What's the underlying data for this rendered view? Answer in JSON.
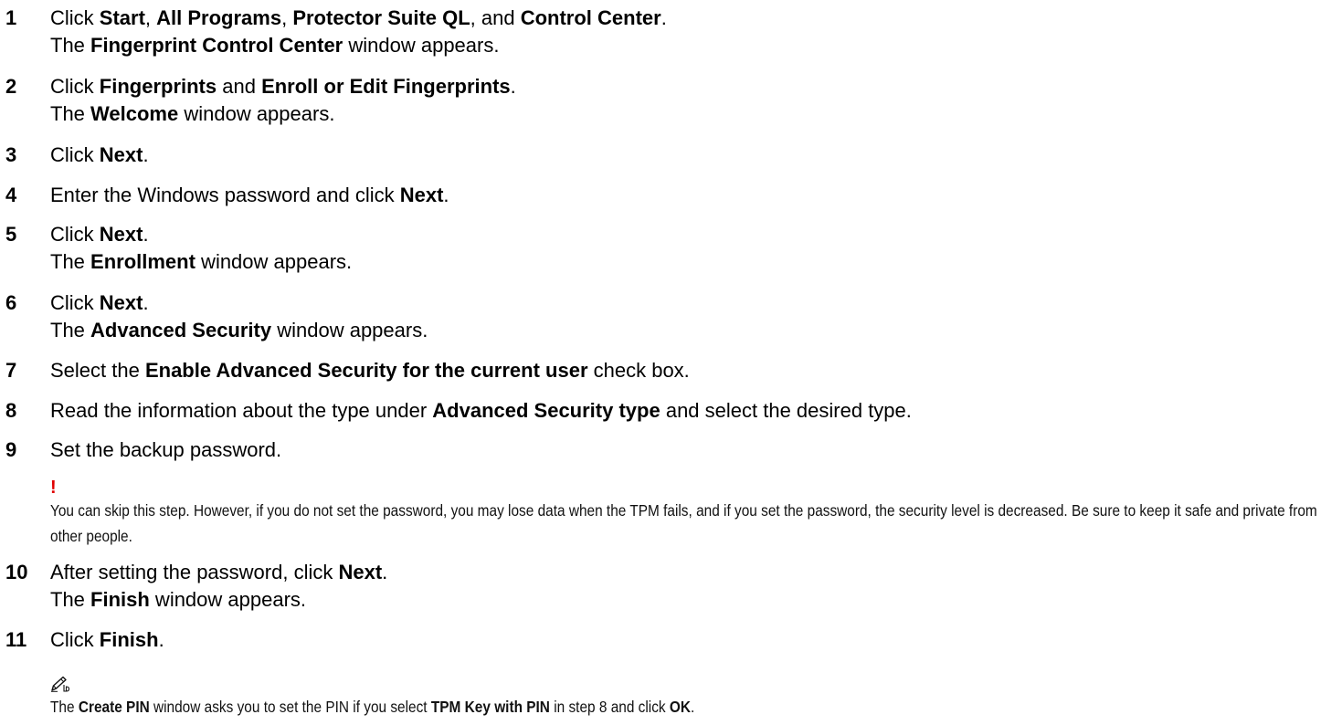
{
  "steps": [
    {
      "n": "1",
      "lines": [
        [
          {
            "t": "Click "
          },
          {
            "t": "Start",
            "b": 1
          },
          {
            "t": ", "
          },
          {
            "t": "All Programs",
            "b": 1
          },
          {
            "t": ", "
          },
          {
            "t": "Protector Suite QL",
            "b": 1
          },
          {
            "t": ", and "
          },
          {
            "t": "Control Center",
            "b": 1
          },
          {
            "t": "."
          }
        ],
        [
          {
            "t": "The "
          },
          {
            "t": "Fingerprint Control Center",
            "b": 1
          },
          {
            "t": " window appears."
          }
        ]
      ]
    },
    {
      "n": "2",
      "lines": [
        [
          {
            "t": "Click "
          },
          {
            "t": "Fingerprints",
            "b": 1
          },
          {
            "t": " and "
          },
          {
            "t": "Enroll or Edit Fingerprints",
            "b": 1
          },
          {
            "t": "."
          }
        ],
        [
          {
            "t": "The "
          },
          {
            "t": "Welcome",
            "b": 1
          },
          {
            "t": " window appears."
          }
        ]
      ]
    },
    {
      "n": "3",
      "lines": [
        [
          {
            "t": "Click "
          },
          {
            "t": "Next",
            "b": 1
          },
          {
            "t": "."
          }
        ]
      ]
    },
    {
      "n": "4",
      "lines": [
        [
          {
            "t": "Enter the Windows password and click "
          },
          {
            "t": "Next",
            "b": 1
          },
          {
            "t": "."
          }
        ]
      ]
    },
    {
      "n": "5",
      "lines": [
        [
          {
            "t": "Click "
          },
          {
            "t": "Next",
            "b": 1
          },
          {
            "t": "."
          }
        ],
        [
          {
            "t": "The "
          },
          {
            "t": "Enrollment",
            "b": 1
          },
          {
            "t": " window appears."
          }
        ]
      ]
    },
    {
      "n": "6",
      "lines": [
        [
          {
            "t": "Click "
          },
          {
            "t": "Next",
            "b": 1
          },
          {
            "t": "."
          }
        ],
        [
          {
            "t": "The "
          },
          {
            "t": "Advanced Security",
            "b": 1
          },
          {
            "t": " window appears."
          }
        ]
      ]
    },
    {
      "n": "7",
      "lines": [
        [
          {
            "t": "Select the "
          },
          {
            "t": "Enable Advanced Security for the current user",
            "b": 1
          },
          {
            "t": " check box."
          }
        ]
      ]
    },
    {
      "n": "8",
      "lines": [
        [
          {
            "t": "Read the information about the type under "
          },
          {
            "t": "Advanced Security type",
            "b": 1
          },
          {
            "t": " and select the desired type."
          }
        ]
      ]
    },
    {
      "n": "9",
      "lines": [
        [
          {
            "t": "Set the backup password."
          }
        ]
      ]
    },
    {
      "n": "10",
      "lines": [
        [
          {
            "t": "After setting the password, click "
          },
          {
            "t": "Next",
            "b": 1
          },
          {
            "t": "."
          }
        ],
        [
          {
            "t": "The "
          },
          {
            "t": "Finish",
            "b": 1
          },
          {
            "t": " window appears."
          }
        ]
      ]
    },
    {
      "n": "11",
      "lines": [
        [
          {
            "t": "Click "
          },
          {
            "t": "Finish",
            "b": 1
          },
          {
            "t": "."
          }
        ]
      ]
    }
  ],
  "caution": {
    "symbol": "!",
    "text": "You can skip this step. However, if you do not set the password, you may lose data when the TPM fails, and if you set the password, the security level is decreased. Be sure to keep it safe and private from other people.",
    "icon": "caution-exclamation-icon",
    "color": "#e00000"
  },
  "note": {
    "icon": "note-pen-icon",
    "segments": [
      {
        "t": "The "
      },
      {
        "t": "Create PIN",
        "b": 1
      },
      {
        "t": " window asks you to set the PIN if you select "
      },
      {
        "t": "TPM Key with PIN",
        "b": 1
      },
      {
        "t": " in step 8 and click "
      },
      {
        "t": "OK",
        "b": 1
      },
      {
        "t": "."
      }
    ]
  }
}
